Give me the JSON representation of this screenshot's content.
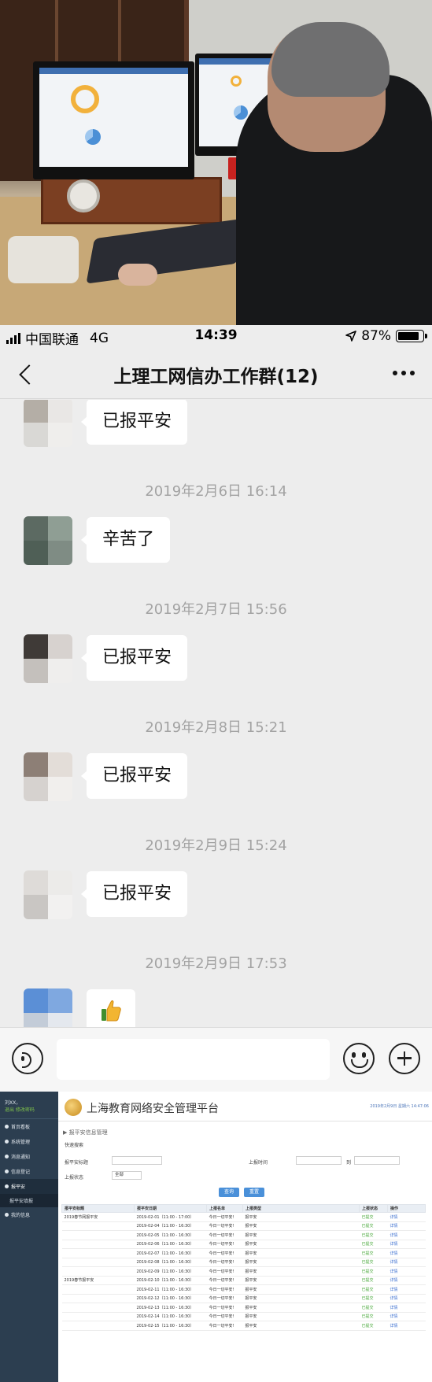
{
  "status_bar": {
    "carrier": "中国联通",
    "network": "4G",
    "time": "14:39",
    "battery": "87%",
    "battery_level": 0.87
  },
  "nav": {
    "title": "上理工网信办工作群(12)"
  },
  "messages": [
    {
      "type": "text",
      "text": "已报平安",
      "avatar_colors": [
        "#b4aea6",
        "#e9e7e5",
        "#d9d8d5",
        "#efeeec"
      ]
    },
    {
      "type": "timestamp",
      "text": "2019年2月6日 16:14"
    },
    {
      "type": "text",
      "text": "辛苦了",
      "avatar_colors": [
        "#5c6a62",
        "#8f9e94",
        "#4f5f56",
        "#7f8c84"
      ]
    },
    {
      "type": "timestamp",
      "text": "2019年2月7日 15:56"
    },
    {
      "type": "text",
      "text": "已报平安",
      "avatar_colors": [
        "#3f3a37",
        "#d7d2cf",
        "#c4c0bc",
        "#efeeed"
      ]
    },
    {
      "type": "timestamp",
      "text": "2019年2月8日 15:21"
    },
    {
      "type": "text",
      "text": "已报平安",
      "avatar_colors": [
        "#8d7f76",
        "#e3ddd8",
        "#d6d2cf",
        "#f1efed"
      ]
    },
    {
      "type": "timestamp",
      "text": "2019年2月9日 15:24"
    },
    {
      "type": "text",
      "text": "已报平安",
      "avatar_colors": [
        "#dedbd8",
        "#ecebe9",
        "#c9c6c3",
        "#f2f1f0"
      ]
    },
    {
      "type": "timestamp",
      "text": "2019年2月9日 17:53"
    },
    {
      "type": "sticker",
      "sticker": "thumbs-up",
      "avatar_colors": [
        "#5b8fd6",
        "#7fa8e0",
        "#c3ccd8",
        "#e4e8ee"
      ]
    }
  ],
  "admin": {
    "title": "上海教育网络安全管理平台",
    "date_text": "2019年2月9日 星期六 14:47:06",
    "sidebar": {
      "user_line1": "刘XX，",
      "user_line2": "退出  修改密码",
      "items": [
        "首页看板",
        "系统管理",
        "消息通知",
        "信息登记",
        "报平安"
      ],
      "sub_item": "报平安填报",
      "last_item": "我的信息"
    },
    "breadcrumb": "▶ 报平安信息管理",
    "quick_search": "快速搜索",
    "form": {
      "name_label": "报平安标题",
      "time_label": "上报时间",
      "to_label": "到",
      "status_label": "上报状态",
      "status_value": "全部",
      "search_button": "查询",
      "reset_button": "重置"
    },
    "table": {
      "headers": [
        "报平安标题",
        "报平安日期",
        "上报名单",
        "上报类型",
        "上报状态",
        "操作"
      ],
      "group1": "2019春节网报平安",
      "group2": "2019春节报平安",
      "rows": [
        [
          "2019-02-01（11:00 - 17:00）",
          "今日一切平安!",
          "报平安",
          "已提交",
          "详情"
        ],
        [
          "2019-02-04（11:00 - 16:30）",
          "今日一切平安!",
          "报平安",
          "已提交",
          "详情"
        ],
        [
          "2019-02-05（11:00 - 16:30）",
          "今日一切平安!",
          "报平安",
          "已提交",
          "详情"
        ],
        [
          "2019-02-06（11:00 - 16:30）",
          "今日一切平安!",
          "报平安",
          "已提交",
          "详情"
        ],
        [
          "2019-02-07（11:00 - 16:30）",
          "今日一切平安!",
          "报平安",
          "已提交",
          "详情"
        ],
        [
          "2019-02-08（11:00 - 16:30）",
          "今日一切平安!",
          "报平安",
          "已提交",
          "详情"
        ],
        [
          "2019-02-09（11:00 - 16:30）",
          "今日一切平安!",
          "报平安",
          "已提交",
          "详情"
        ],
        [
          "2019-02-10（11:00 - 16:30）",
          "今日一切平安!",
          "报平安",
          "已提交",
          "详情"
        ],
        [
          "2019-02-11（11:00 - 16:30）",
          "今日一切平安!",
          "报平安",
          "已提交",
          "详情"
        ],
        [
          "2019-02-12（11:00 - 16:30）",
          "今日一切平安!",
          "报平安",
          "已提交",
          "详情"
        ],
        [
          "2019-02-13（11:00 - 16:30）",
          "今日一切平安!",
          "报平安",
          "已提交",
          "详情"
        ],
        [
          "2019-02-14（11:00 - 16:30）",
          "今日一切平安!",
          "报平安",
          "已提交",
          "详情"
        ],
        [
          "2019-02-15（11:00 - 16:30）",
          "今日一切平安!",
          "报平安",
          "已提交",
          "详情"
        ]
      ]
    }
  }
}
